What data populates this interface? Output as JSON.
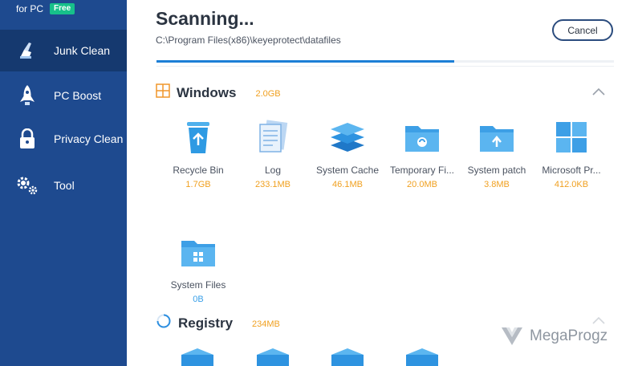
{
  "sidebar": {
    "brand_text": "for PC",
    "brand_badge": "Free",
    "items": [
      {
        "label": "Junk Clean",
        "icon": "broom-icon"
      },
      {
        "label": "PC Boost",
        "icon": "rocket-icon"
      },
      {
        "label": "Privacy Clean",
        "icon": "lock-icon"
      },
      {
        "label": "Tool",
        "icon": "gears-icon"
      }
    ]
  },
  "main": {
    "title": "Scanning...",
    "path": "C:\\Program Files(x86)\\keyeprotect\\datafiles",
    "cancel_label": "Cancel",
    "progress": 0.65
  },
  "sections": {
    "windows": {
      "title": "Windows",
      "size": "2.0GB",
      "items": [
        {
          "label": "Recycle Bin",
          "size": "1.7GB"
        },
        {
          "label": "Log",
          "size": "233.1MB"
        },
        {
          "label": "System Cache",
          "size": "46.1MB"
        },
        {
          "label": "Temporary Fi...",
          "size": "20.0MB"
        },
        {
          "label": "System patch",
          "size": "3.8MB"
        },
        {
          "label": "Microsoft Pr...",
          "size": "412.0KB"
        },
        {
          "label": "System Files",
          "size": "0B"
        }
      ]
    },
    "registry": {
      "title": "Registry",
      "size": "234MB"
    }
  },
  "watermark": "MegaProgz",
  "colors": {
    "sidebar": "#1e4a8f",
    "sidebar_active": "#15396f",
    "accent_blue": "#1c7fd6",
    "size_orange": "#f0a020",
    "badge_green": "#17c08a"
  }
}
